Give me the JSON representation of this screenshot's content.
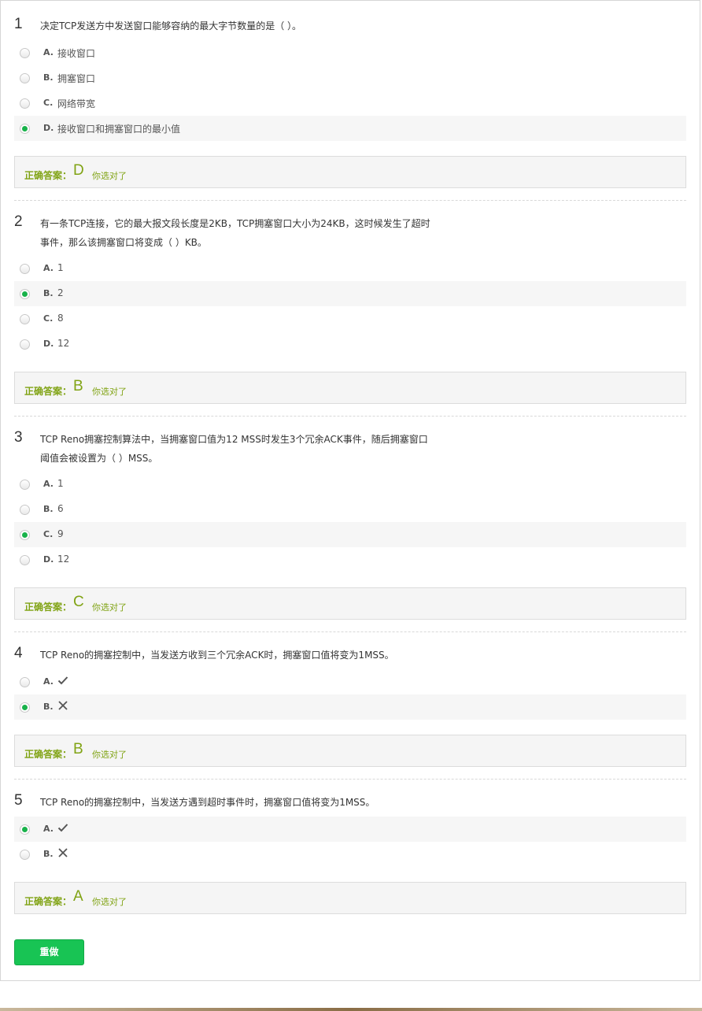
{
  "questions": [
    {
      "number": "1",
      "text": "决定TCP发送方中发送窗口能够容纳的最大字节数量的是（    ）。",
      "options": [
        {
          "letter": "A.",
          "text": "接收窗口",
          "selected": false
        },
        {
          "letter": "B.",
          "text": "拥塞窗口",
          "selected": false
        },
        {
          "letter": "C.",
          "text": "网络带宽",
          "selected": false
        },
        {
          "letter": "D.",
          "text": "接收窗口和拥塞窗口的最小值",
          "selected": true
        }
      ],
      "answer_label": "正确答案：",
      "answer_value": "D",
      "answer_note": "你选对了"
    },
    {
      "number": "2",
      "text": "有一条TCP连接，它的最大报文段长度是2KB，TCP拥塞窗口大小为24KB，这时候发生了超时事件，那么该拥塞窗口将变成（    ）KB。",
      "options": [
        {
          "letter": "A.",
          "text": "1",
          "selected": false
        },
        {
          "letter": "B.",
          "text": "2",
          "selected": true
        },
        {
          "letter": "C.",
          "text": "8",
          "selected": false
        },
        {
          "letter": "D.",
          "text": "12",
          "selected": false
        }
      ],
      "answer_label": "正确答案：",
      "answer_value": "B",
      "answer_note": "你选对了"
    },
    {
      "number": "3",
      "text": "TCP Reno拥塞控制算法中，当拥塞窗口值为12 MSS时发生3个冗余ACK事件，随后拥塞窗口阈值会被设置为（    ）MSS。",
      "options": [
        {
          "letter": "A.",
          "text": "1",
          "selected": false
        },
        {
          "letter": "B.",
          "text": "6",
          "selected": false
        },
        {
          "letter": "C.",
          "text": "9",
          "selected": true
        },
        {
          "letter": "D.",
          "text": "12",
          "selected": false
        }
      ],
      "answer_label": "正确答案：",
      "answer_value": "C",
      "answer_note": "你选对了"
    },
    {
      "number": "4",
      "text": "TCP Reno的拥塞控制中，当发送方收到三个冗余ACK时，拥塞窗口值将变为1MSS。",
      "options": [
        {
          "letter": "A.",
          "icon": "check-icon",
          "selected": false
        },
        {
          "letter": "B.",
          "icon": "cross-icon",
          "selected": true
        }
      ],
      "answer_label": "正确答案：",
      "answer_value": "B",
      "answer_note": "你选对了"
    },
    {
      "number": "5",
      "text": "TCP Reno的拥塞控制中，当发送方遇到超时事件时，拥塞窗口值将变为1MSS。",
      "options": [
        {
          "letter": "A.",
          "icon": "check-icon",
          "selected": true
        },
        {
          "letter": "B.",
          "icon": "cross-icon",
          "selected": false
        }
      ],
      "answer_label": "正确答案：",
      "answer_value": "A",
      "answer_note": "你选对了"
    }
  ],
  "redo_button": "重做",
  "colors": {
    "accent_green": "#18c454",
    "radio_selected": "#18b24a",
    "answer_text": "#80a314"
  }
}
